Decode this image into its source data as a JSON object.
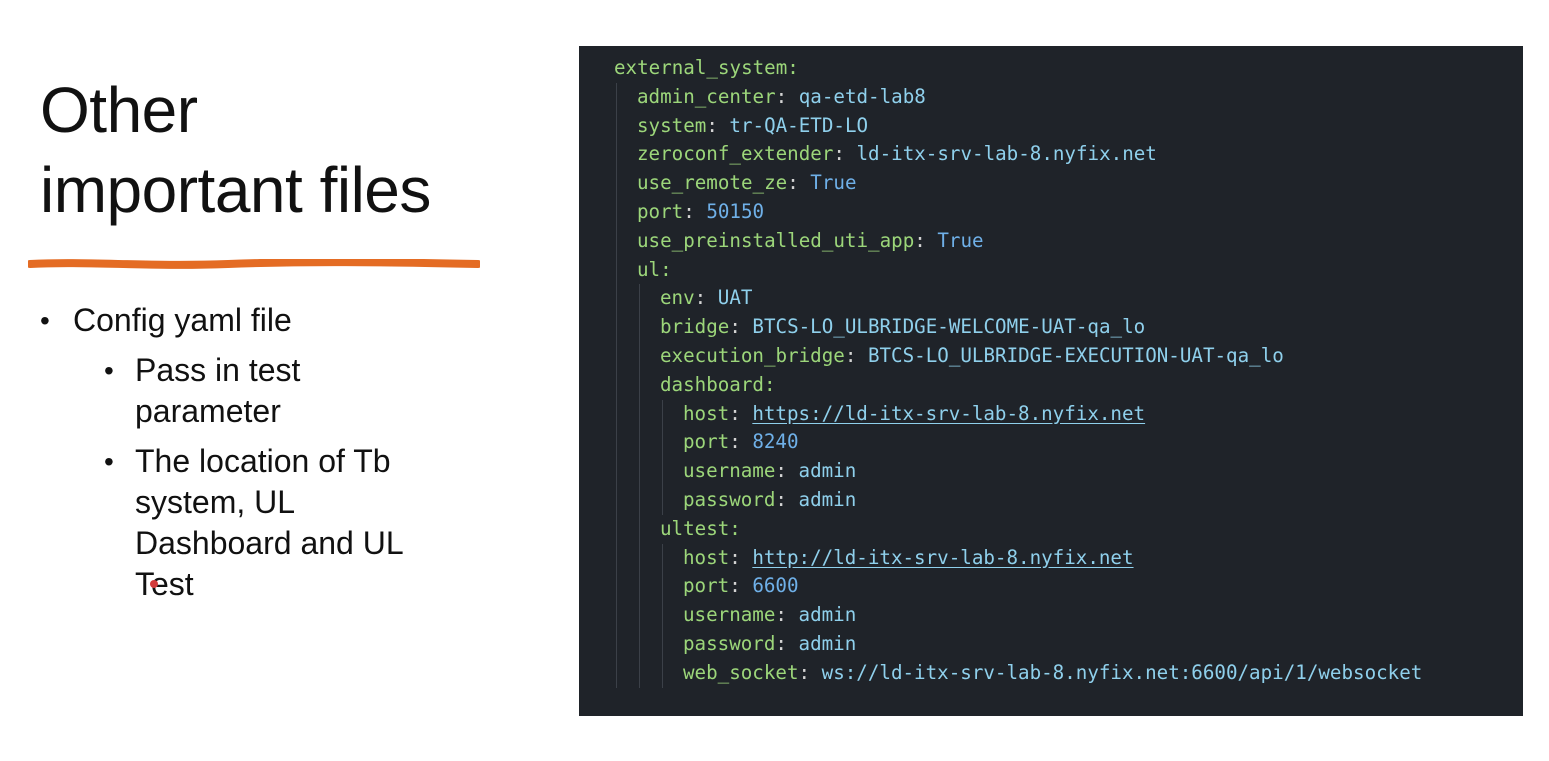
{
  "slide": {
    "title": "Other important files",
    "title_line1": "Other",
    "title_line2": "important files",
    "accent_color": "#e46c24",
    "bullets": [
      {
        "text": "Config yaml file",
        "sub": [
          {
            "line1": "Pass in test",
            "line2": "parameter"
          },
          {
            "line1": "The location of Tb",
            "line2": "system, UL",
            "line3": "Dashboard and UL",
            "line4": "Test"
          }
        ]
      }
    ]
  },
  "code": {
    "background": "#1f2329",
    "lines": [
      {
        "key": "external_system:",
        "val": "",
        "indent": 0
      },
      {
        "key": "admin_center",
        "val": "qa-etd-lab8",
        "indent": 1
      },
      {
        "key": "system",
        "val": "tr-QA-ETD-LO",
        "indent": 1
      },
      {
        "key": "zeroconf_extender",
        "val": "ld-itx-srv-lab-8.nyfix.net",
        "indent": 1
      },
      {
        "key": "use_remote_ze",
        "val": "True",
        "indent": 1
      },
      {
        "key": "port",
        "val": "50150",
        "indent": 1
      },
      {
        "key": "use_preinstalled_uti_app",
        "val": "True",
        "indent": 1
      },
      {
        "key": "ul:",
        "val": "",
        "indent": 1
      },
      {
        "key": "env",
        "val": "UAT",
        "indent": 2
      },
      {
        "key": "bridge",
        "val": "BTCS-LO_ULBRIDGE-WELCOME-UAT-qa_lo",
        "indent": 2
      },
      {
        "key": "execution_bridge",
        "val": "BTCS-LO_ULBRIDGE-EXECUTION-UAT-qa_lo",
        "indent": 2
      },
      {
        "key": "dashboard:",
        "val": "",
        "indent": 2
      },
      {
        "key": "host",
        "val": "https://ld-itx-srv-lab-8.nyfix.net",
        "indent": 3
      },
      {
        "key": "port",
        "val": "8240",
        "indent": 3
      },
      {
        "key": "username",
        "val": "admin",
        "indent": 3
      },
      {
        "key": "password",
        "val": "admin",
        "indent": 3
      },
      {
        "key": "ultest:",
        "val": "",
        "indent": 2
      },
      {
        "key": "host",
        "val": "http://ld-itx-srv-lab-8.nyfix.net",
        "indent": 3
      },
      {
        "key": "port",
        "val": "6600",
        "indent": 3
      },
      {
        "key": "username",
        "val": "admin",
        "indent": 3
      },
      {
        "key": "password",
        "val": "admin",
        "indent": 3
      },
      {
        "key": "web_socket",
        "val": "ws://ld-itx-srv-lab-8.nyfix.net:6600/api/1/websocket",
        "indent": 3
      }
    ]
  }
}
